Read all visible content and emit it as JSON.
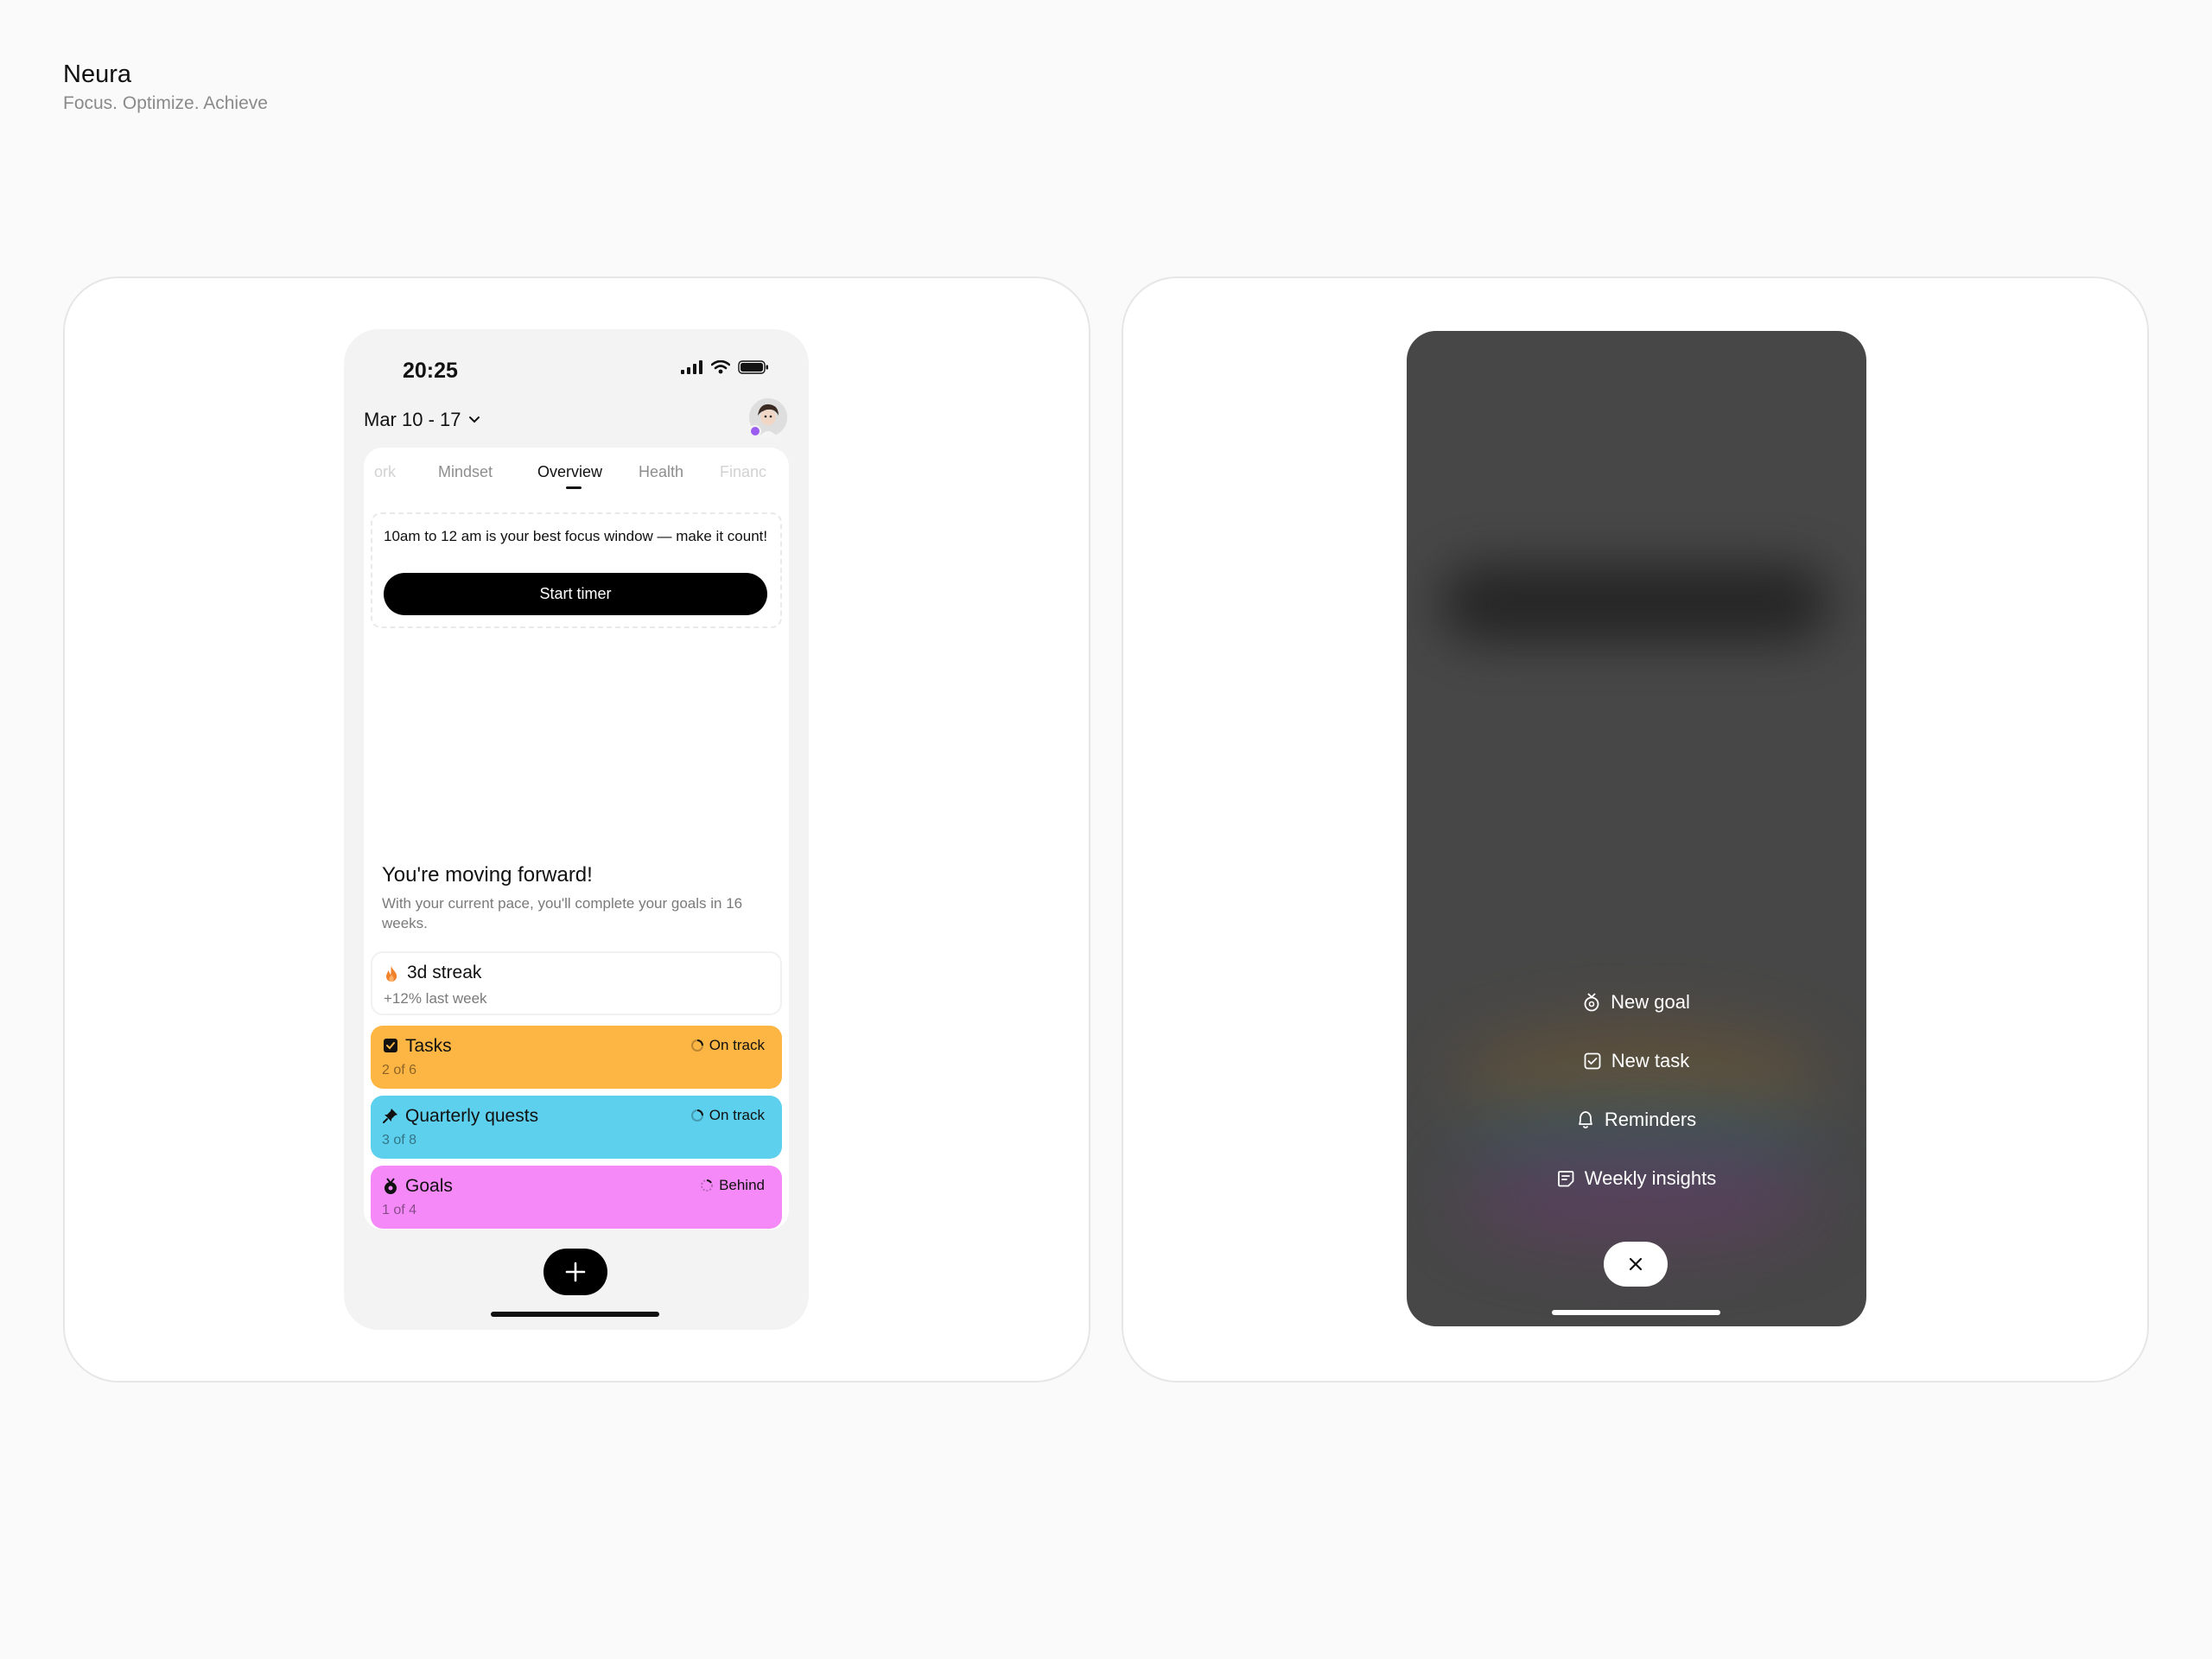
{
  "brand": {
    "name": "Neura",
    "tagline": "Focus. Optimize. Achieve"
  },
  "left_phone": {
    "status_time": "20:25",
    "date_range": "Mar 10 - 17",
    "tabs": [
      "ork",
      "Mindset",
      "Overview",
      "Health",
      "Financ"
    ],
    "active_tab": "Overview",
    "focus_message": "10am to 12 am is your best focus window — make it count!",
    "start_timer_label": "Start timer",
    "progress_title": "You're moving forward!",
    "progress_subtitle": "With your current pace, you'll complete your goals in 16 weeks.",
    "streak": {
      "title": "3d streak",
      "subtitle": "+12% last week",
      "icon": "flame-icon"
    },
    "cards": [
      {
        "title": "Tasks",
        "count": "2 of 6",
        "status": "On track",
        "color": "#FDB544",
        "icon": "checkbox-icon"
      },
      {
        "title": "Quarterly quests",
        "count": "3 of 8",
        "status": "On track",
        "color": "#5DD0EE",
        "icon": "pin-icon"
      },
      {
        "title": "Goals",
        "count": "1 of 4",
        "status": "Behind",
        "color": "#F589F8",
        "icon": "medal-icon"
      }
    ]
  },
  "right_phone": {
    "menu": [
      {
        "label": "New goal",
        "icon": "medal-icon"
      },
      {
        "label": "New task",
        "icon": "checkbox-icon"
      },
      {
        "label": "Reminders",
        "icon": "bell-icon"
      },
      {
        "label": "Weekly insights",
        "icon": "insights-icon"
      }
    ]
  }
}
